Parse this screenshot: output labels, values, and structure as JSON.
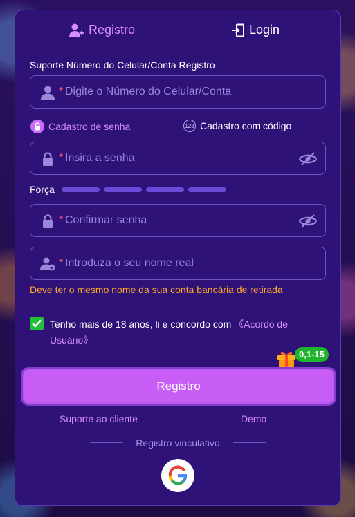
{
  "tabs": {
    "register": "Registro",
    "login": "Login"
  },
  "section_label": "Suporte Número do Celular/Conta Registro",
  "phone": {
    "required_mark": "*",
    "placeholder": "Digite o Número do Celular/Conta"
  },
  "options": {
    "password_signup": "Cadastro de senha",
    "code_signup": "Cadastro com código",
    "code_icon_text": "123"
  },
  "password": {
    "required_mark": "*",
    "placeholder": "Insira a senha"
  },
  "strength": {
    "label": "Força",
    "segments": 4
  },
  "confirm": {
    "required_mark": "*",
    "placeholder": "Confirmar senha"
  },
  "realname": {
    "required_mark": "*",
    "placeholder": "Introduza o seu nome real"
  },
  "warning": "Deve ter o mesmo nome da sua conta bancária de retirada",
  "agreement": {
    "checked": true,
    "text": "Tenho mais de 18 anos, li e concordo com ",
    "link": "《Acordo de Usuário》"
  },
  "bonus_badge": "0,1-15",
  "register_button": "Registro",
  "footer": {
    "support": "Suporte ao cliente",
    "demo": "Demo",
    "bind_label": "Registro vinculativo"
  },
  "colors": {
    "accent": "#d88bff",
    "panel": "#2e1278",
    "button": "#c85df5",
    "warning": "#ffa62b",
    "check": "#1fbf3a"
  }
}
